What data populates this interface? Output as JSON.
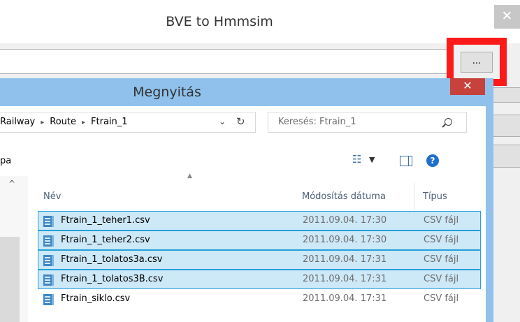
{
  "window": {
    "title": "BVE to Hmmsim",
    "close_glyph": "✕",
    "browse_label": "..."
  },
  "dialog": {
    "title": "Megnyitás",
    "close_glyph": "✕",
    "breadcrumb": [
      "Railway",
      "Route",
      "Ftrain_1"
    ],
    "breadcrumb_sep": "▸",
    "dropdown_glyph": "⌄",
    "refresh_glyph": "↻",
    "search_placeholder": "Keresés: Ftrain_1",
    "toolbar_left": "pa",
    "view_icon_glyph": "☷",
    "view_dropdown_glyph": "▼",
    "help_glyph": "?",
    "nav_scroll_up_glyph": "^",
    "sort_arrow_glyph": "▲",
    "columns": {
      "name": "Név",
      "date": "Módosítás dátuma",
      "type": "Típus"
    },
    "files": [
      {
        "name": "Ftrain_1_teher1.csv",
        "date": "2011.09.04. 17:30",
        "type": "CSV fájl",
        "selected": true
      },
      {
        "name": "Ftrain_1_teher2.csv",
        "date": "2011.09.04. 17:30",
        "type": "CSV fájl",
        "selected": true
      },
      {
        "name": "Ftrain_1_tolatos3a.csv",
        "date": "2011.09.04. 17:31",
        "type": "CSV fájl",
        "selected": true
      },
      {
        "name": "Ftrain_1_tolatos3B.csv",
        "date": "2011.09.04. 17:31",
        "type": "CSV fájl",
        "selected": true
      },
      {
        "name": "Ftrain_siklo.csv",
        "date": "2011.09.04. 17:31",
        "type": "CSV fájl",
        "selected": false
      }
    ]
  },
  "colors": {
    "highlight": "#ff1a1a",
    "selection_bg": "#cde8f7",
    "selection_border": "#26a0da",
    "dialog_frame": "#8fc1ec",
    "dialog_close": "#c7423c"
  }
}
